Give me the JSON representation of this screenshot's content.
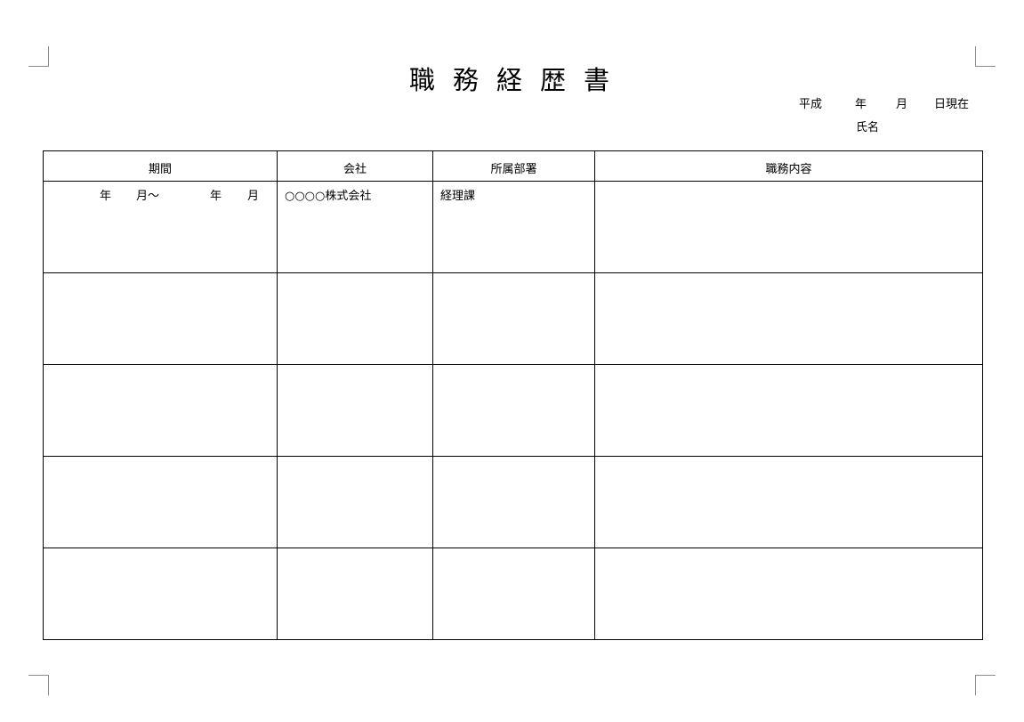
{
  "document": {
    "title": "職務経歴書",
    "title_chars": [
      "職",
      "務",
      "経",
      "歴",
      "書"
    ],
    "date_line": {
      "era": "平成",
      "year_label": "年",
      "month_label": "月",
      "day_suffix": "日現在"
    },
    "name_label": "氏名"
  },
  "table": {
    "columns": [
      "期間",
      "会社",
      "所属部署",
      "職務内容"
    ],
    "rows": [
      {
        "period": {
          "start_year": "年",
          "start_month": "月〜",
          "end_year": "年",
          "end_month": "月"
        },
        "company": "○○○○株式会社",
        "department": "経理課",
        "duties": ""
      },
      {
        "period": null,
        "company": "",
        "department": "",
        "duties": ""
      },
      {
        "period": null,
        "company": "",
        "department": "",
        "duties": ""
      },
      {
        "period": null,
        "company": "",
        "department": "",
        "duties": ""
      },
      {
        "period": null,
        "company": "",
        "department": "",
        "duties": ""
      }
    ]
  }
}
